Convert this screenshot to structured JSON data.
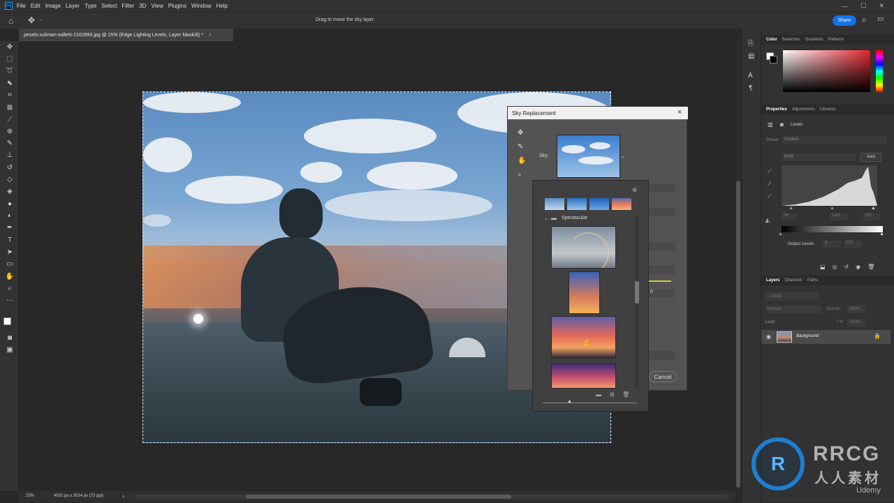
{
  "menu": {
    "items": [
      "File",
      "Edit",
      "Image",
      "Layer",
      "Type",
      "Select",
      "Filter",
      "3D",
      "View",
      "Plugins",
      "Window",
      "Help"
    ]
  },
  "options_bar": {
    "hint": "Drag to move the sky layer.",
    "share_label": "Share"
  },
  "document": {
    "tab_title": "pexels-suliman-sallehi-2162893.jpg @ 25% (Edge Lighting Levels, Layer Mask/8) *",
    "close_glyph": "×"
  },
  "status": {
    "zoom": "25%",
    "info": "4032 px x 3024 px (72 ppi)",
    "arrow": "›"
  },
  "color_panel": {
    "tabs": [
      "Color",
      "Swatches",
      "Gradients",
      "Patterns"
    ]
  },
  "properties_panel": {
    "tabs": [
      "Properties",
      "Adjustments",
      "Libraries"
    ],
    "layer_type": "Levels",
    "preset_label": "Preset:",
    "preset_value": "Custom",
    "channel_value": "RGB",
    "auto_label": "Auto",
    "input_values": [
      "26",
      "1.00",
      "255"
    ],
    "output_label": "Output Levels:",
    "output_values": [
      "0",
      "255"
    ]
  },
  "layers_panel": {
    "tabs": [
      "Layers",
      "Channels",
      "Paths"
    ],
    "kind_placeholder": "Kind",
    "blend_mode": "Normal",
    "opacity_label": "Opacity:",
    "opacity_value": "100%",
    "lock_label": "Lock:",
    "fill_label": "Fill:",
    "fill_value": "100%",
    "layer_name": "Background"
  },
  "dialog": {
    "title": "Sky Replacement",
    "sky_label": "Sky:",
    "cancel_label": "Cancel",
    "field_value": "0",
    "close_glyph": "×"
  },
  "sky_picker": {
    "group_name": "Spectacular"
  },
  "watermark": {
    "brand": "RRCG",
    "subtitle": "人人素材",
    "site": "Udemy"
  },
  "colors": {
    "accent": "#1473e6",
    "ps_blue": "#31a8ff",
    "dialog_bg": "#535353",
    "panel_bg": "#323232"
  }
}
